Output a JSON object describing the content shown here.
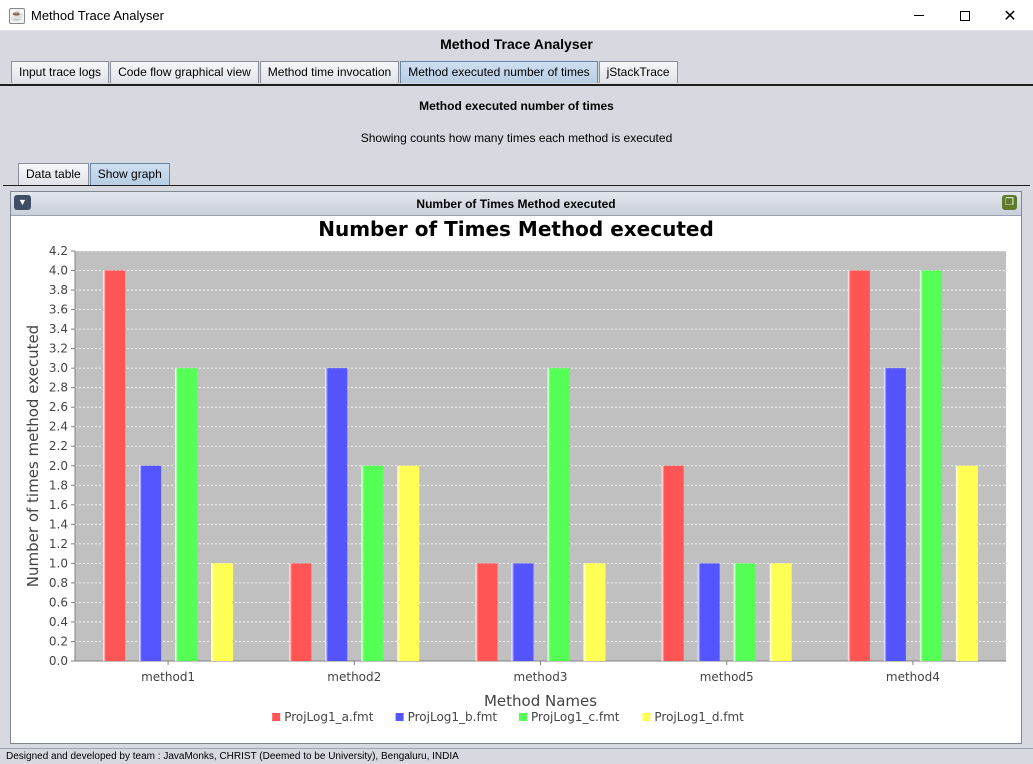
{
  "window": {
    "title": "Method Trace Analyser",
    "minimize_label": "—",
    "close_label": "✕"
  },
  "app": {
    "header": "Method Trace Analyser",
    "tabs": [
      {
        "label": "Input trace logs",
        "active": false
      },
      {
        "label": "Code flow graphical view",
        "active": false
      },
      {
        "label": "Method time invocation",
        "active": false
      },
      {
        "label": "Method executed number of times",
        "active": true
      },
      {
        "label": "jStackTrace",
        "active": false
      }
    ]
  },
  "panel": {
    "title": "Method executed number of times",
    "subtitle": "Showing counts how many times each method is executed",
    "subtabs": [
      {
        "label": "Data table",
        "active": false
      },
      {
        "label": "Show graph",
        "active": true
      }
    ]
  },
  "frame": {
    "title": "Number of Times Method executed"
  },
  "chart_data": {
    "type": "bar",
    "title": "Number of Times Method executed",
    "xlabel": "Method Names",
    "ylabel": "Number of times method executed",
    "ylim": [
      0,
      4.2
    ],
    "ytick_step": 0.2,
    "grid": true,
    "legend_position": "bottom",
    "categories": [
      "method1",
      "method2",
      "method3",
      "method5",
      "method4"
    ],
    "series": [
      {
        "name": "ProjLog1_a.fmt",
        "color": "#ff5555",
        "values": [
          4,
          1,
          1,
          2,
          4
        ]
      },
      {
        "name": "ProjLog1_b.fmt",
        "color": "#5555ff",
        "values": [
          2,
          3,
          1,
          1,
          3
        ]
      },
      {
        "name": "ProjLog1_c.fmt",
        "color": "#55ff55",
        "values": [
          3,
          2,
          3,
          1,
          4
        ]
      },
      {
        "name": "ProjLog1_d.fmt",
        "color": "#ffff55",
        "values": [
          1,
          2,
          1,
          1,
          2
        ]
      }
    ]
  },
  "footer": {
    "text": "Designed and developed by team : JavaMonks, CHRIST (Deemed to be University), Bengaluru, INDIA"
  }
}
